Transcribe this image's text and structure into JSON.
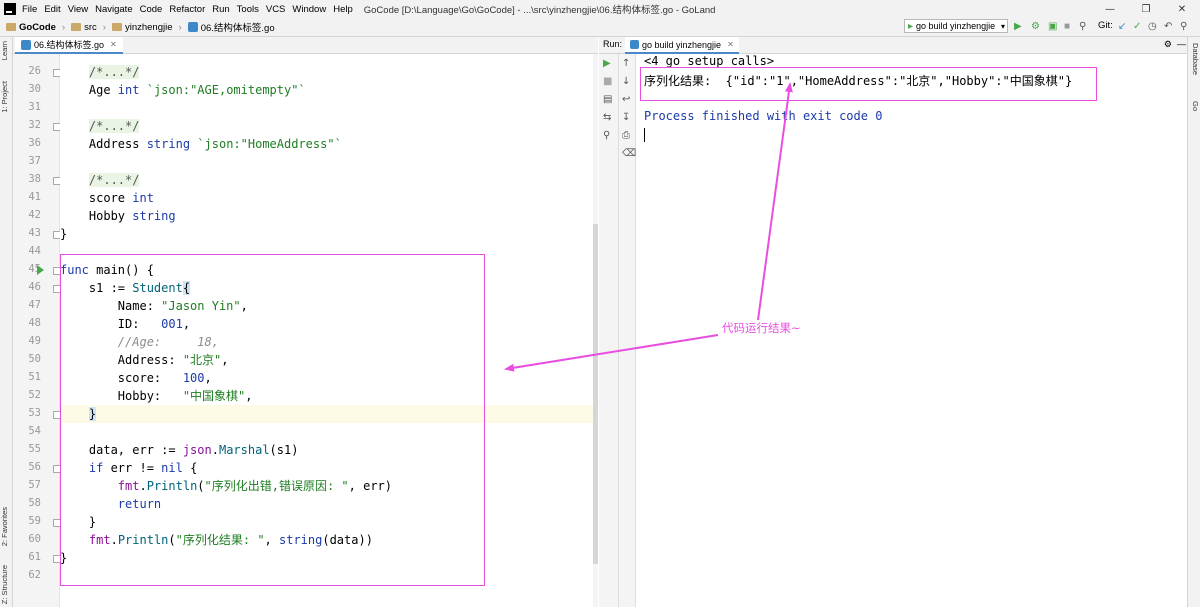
{
  "menubar": {
    "items": [
      "File",
      "Edit",
      "View",
      "Navigate",
      "Code",
      "Refactor",
      "Run",
      "Tools",
      "VCS",
      "Window",
      "Help"
    ],
    "window_title": "GoCode [D:\\Language\\Go\\GoCode] - ...\\src\\yinzhengjie\\06.结构体标签.go - GoLand"
  },
  "navbar": {
    "crumbs": [
      "GoCode",
      "src",
      "yinzhengjie",
      "06.结构体标签.go"
    ],
    "run_config": "go build yinzhengjie",
    "git_label": "Git:"
  },
  "editor": {
    "tab_label": "06.结构体标签.go",
    "line_numbers": [
      "26",
      "30",
      "31",
      "32",
      "36",
      "37",
      "38",
      "41",
      "42",
      "43",
      "44",
      "45",
      "46",
      "47",
      "48",
      "49",
      "50",
      "51",
      "52",
      "53",
      "54",
      "55",
      "56",
      "57",
      "58",
      "59",
      "60",
      "61",
      "62"
    ],
    "lines": [
      [
        {
          "t": "    "
        },
        {
          "t": "/*...*/",
          "c": "fold-cmt"
        }
      ],
      [
        {
          "t": "    Age "
        },
        {
          "t": "int",
          "c": "kw"
        },
        {
          "t": " "
        },
        {
          "t": "`json:\"AGE,omitempty\"`",
          "c": "str"
        }
      ],
      [
        {
          "t": ""
        }
      ],
      [
        {
          "t": "    "
        },
        {
          "t": "/*...*/",
          "c": "fold-cmt"
        }
      ],
      [
        {
          "t": "    Address "
        },
        {
          "t": "string",
          "c": "kw"
        },
        {
          "t": " "
        },
        {
          "t": "`json:\"HomeAddress\"`",
          "c": "str"
        }
      ],
      [
        {
          "t": ""
        }
      ],
      [
        {
          "t": "    "
        },
        {
          "t": "/*...*/",
          "c": "fold-cmt"
        }
      ],
      [
        {
          "t": "    score "
        },
        {
          "t": "int",
          "c": "kw"
        }
      ],
      [
        {
          "t": "    Hobby "
        },
        {
          "t": "string",
          "c": "kw"
        }
      ],
      [
        {
          "t": "}"
        }
      ],
      [
        {
          "t": ""
        }
      ],
      [
        {
          "t": "func",
          "c": "kw"
        },
        {
          "t": " main() {"
        }
      ],
      [
        {
          "t": "    s1 := "
        },
        {
          "t": "Student",
          "c": "fn"
        },
        {
          "t": "{",
          "c": "brace-hl"
        }
      ],
      [
        {
          "t": "        Name: "
        },
        {
          "t": "\"Jason Yin\"",
          "c": "str"
        },
        {
          "t": ","
        }
      ],
      [
        {
          "t": "        ID:   "
        },
        {
          "t": "001",
          "c": "num"
        },
        {
          "t": ","
        }
      ],
      [
        {
          "t": "        "
        },
        {
          "t": "//Age:     18,",
          "c": "cmt"
        }
      ],
      [
        {
          "t": "        Address: "
        },
        {
          "t": "\"北京\"",
          "c": "str"
        },
        {
          "t": ","
        }
      ],
      [
        {
          "t": "        score:   "
        },
        {
          "t": "100",
          "c": "num"
        },
        {
          "t": ","
        }
      ],
      [
        {
          "t": "        Hobby:   "
        },
        {
          "t": "\"中国象棋\"",
          "c": "str"
        },
        {
          "t": ","
        }
      ],
      [
        {
          "t": "    "
        },
        {
          "t": "}",
          "c": "brace-hl"
        }
      ],
      [
        {
          "t": ""
        }
      ],
      [
        {
          "t": "    data, err := "
        },
        {
          "t": "json",
          "c": "pkg"
        },
        {
          "t": "."
        },
        {
          "t": "Marshal",
          "c": "fn"
        },
        {
          "t": "(s1)"
        }
      ],
      [
        {
          "t": "    "
        },
        {
          "t": "if",
          "c": "kw"
        },
        {
          "t": " err != "
        },
        {
          "t": "nil",
          "c": "kw"
        },
        {
          "t": " {"
        }
      ],
      [
        {
          "t": "        "
        },
        {
          "t": "fmt",
          "c": "pkg"
        },
        {
          "t": "."
        },
        {
          "t": "Println",
          "c": "fn"
        },
        {
          "t": "("
        },
        {
          "t": "\"序列化出错,错误原因: \"",
          "c": "str"
        },
        {
          "t": ", err)"
        }
      ],
      [
        {
          "t": "        "
        },
        {
          "t": "return",
          "c": "kw"
        }
      ],
      [
        {
          "t": "    }"
        }
      ],
      [
        {
          "t": "    "
        },
        {
          "t": "fmt",
          "c": "pkg"
        },
        {
          "t": "."
        },
        {
          "t": "Println",
          "c": "fn"
        },
        {
          "t": "("
        },
        {
          "t": "\"序列化结果: \"",
          "c": "str"
        },
        {
          "t": ", "
        },
        {
          "t": "string",
          "c": "kw"
        },
        {
          "t": "(data))"
        }
      ],
      [
        {
          "t": "}"
        }
      ],
      [
        {
          "t": ""
        }
      ]
    ]
  },
  "run_panel": {
    "label": "Run:",
    "tab_label": "go build yinzhengjie",
    "console": {
      "setup_calls": "<4 go setup calls>",
      "result": "序列化结果:  {\"id\":\"1\",\"HomeAddress\":\"北京\",\"Hobby\":\"中国象棋\"}",
      "finished": "Process finished with exit code 0"
    }
  },
  "side_strips": {
    "left": [
      "Learn",
      "1: Project",
      "2: Favorites",
      "Z: Structure"
    ],
    "right": [
      "Database",
      "Go"
    ]
  },
  "annotation": {
    "text": "代码运行结果~",
    "color": "#e94ee0"
  }
}
